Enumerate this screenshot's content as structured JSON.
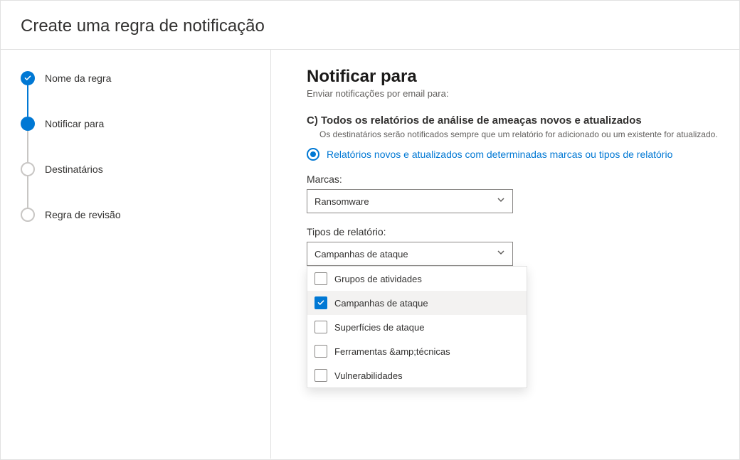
{
  "header": {
    "title": "Create uma regra de notificação"
  },
  "steps": [
    {
      "label": "Nome da regra",
      "state": "done"
    },
    {
      "label": "Notificar para",
      "state": "current"
    },
    {
      "label": "Destinatários",
      "state": "pending"
    },
    {
      "label": "Regra de revisão",
      "state": "pending"
    }
  ],
  "main": {
    "heading": "Notificar para",
    "subtitle": "Enviar notificações por email para:",
    "optionC": {
      "title": "C) Todos os relatórios de análise de ameaças novos e atualizados",
      "desc": "Os destinatários serão notificados sempre que um relatório for adicionado ou um existente for atualizado."
    },
    "radio": {
      "label": "Relatórios novos e atualizados com determinadas marcas ou tipos de relatório"
    },
    "fields": {
      "marcas": {
        "label": "Marcas:",
        "value": "Ransomware"
      },
      "tipos": {
        "label": "Tipos de relatório:",
        "value": "Campanhas de ataque"
      }
    },
    "dropdown": {
      "options": [
        {
          "label": "Grupos de atividades",
          "checked": false
        },
        {
          "label": "Campanhas de ataque",
          "checked": true
        },
        {
          "label": "Superfícies de ataque",
          "checked": false
        },
        {
          "label": "Ferramentas &amp;técnicas",
          "checked": false
        },
        {
          "label": "Vulnerabilidades",
          "checked": false
        }
      ]
    }
  }
}
